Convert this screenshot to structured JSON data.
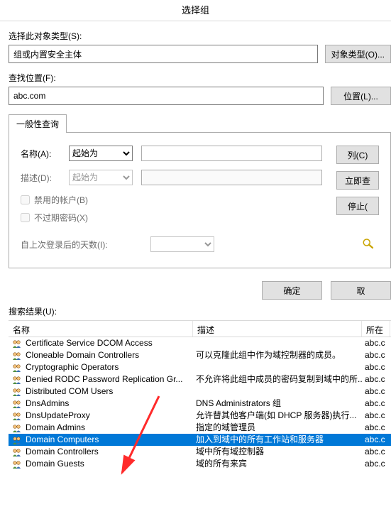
{
  "title": "选择组",
  "object_type_section": {
    "label": "选择此对象类型(S):",
    "value": "组或内置安全主体",
    "button": "对象类型(O)..."
  },
  "location_section": {
    "label": "查找位置(F):",
    "value": "abc.com",
    "button": "位置(L)..."
  },
  "tabs": {
    "general": "一般性查询"
  },
  "query": {
    "name_label": "名称(A):",
    "desc_label": "描述(D):",
    "name_op": "起始为",
    "desc_op": "起始为",
    "disabled_accounts": "禁用的帐户(B)",
    "no_expire_pwd": "不过期密码(X)",
    "days_label": "自上次登录后的天数(I):"
  },
  "side_buttons": {
    "columns": "列(C)",
    "search_now": "立即查",
    "stop": "停止("
  },
  "bottom": {
    "ok": "确定",
    "cancel": "取"
  },
  "results_label": "搜索结果(U):",
  "columns": {
    "name": "名称",
    "desc": "描述",
    "loc": "所在"
  },
  "results": [
    {
      "name": "Certificate Service DCOM Access",
      "desc": "",
      "loc": "abc.c"
    },
    {
      "name": "Cloneable Domain Controllers",
      "desc": "可以克隆此组中作为域控制器的成员。",
      "loc": "abc.c"
    },
    {
      "name": "Cryptographic Operators",
      "desc": "",
      "loc": "abc.c"
    },
    {
      "name": "Denied RODC Password Replication Gr...",
      "desc": "不允许将此组中成员的密码复制到域中的所...",
      "loc": "abc.c"
    },
    {
      "name": "Distributed COM Users",
      "desc": "",
      "loc": "abc.c"
    },
    {
      "name": "DnsAdmins",
      "desc": "DNS Administrators 组",
      "loc": "abc.c"
    },
    {
      "name": "DnsUpdateProxy",
      "desc": "允许替其他客户端(如 DHCP 服务器)执行...",
      "loc": "abc.c"
    },
    {
      "name": "Domain Admins",
      "desc": "指定的域管理员",
      "loc": "abc.c"
    },
    {
      "name": "Domain Computers",
      "desc": "加入到域中的所有工作站和服务器",
      "loc": "abc.c",
      "selected": true
    },
    {
      "name": "Domain Controllers",
      "desc": "域中所有域控制器",
      "loc": "abc.c"
    },
    {
      "name": "Domain Guests",
      "desc": "域的所有来宾",
      "loc": "abc.c"
    }
  ]
}
